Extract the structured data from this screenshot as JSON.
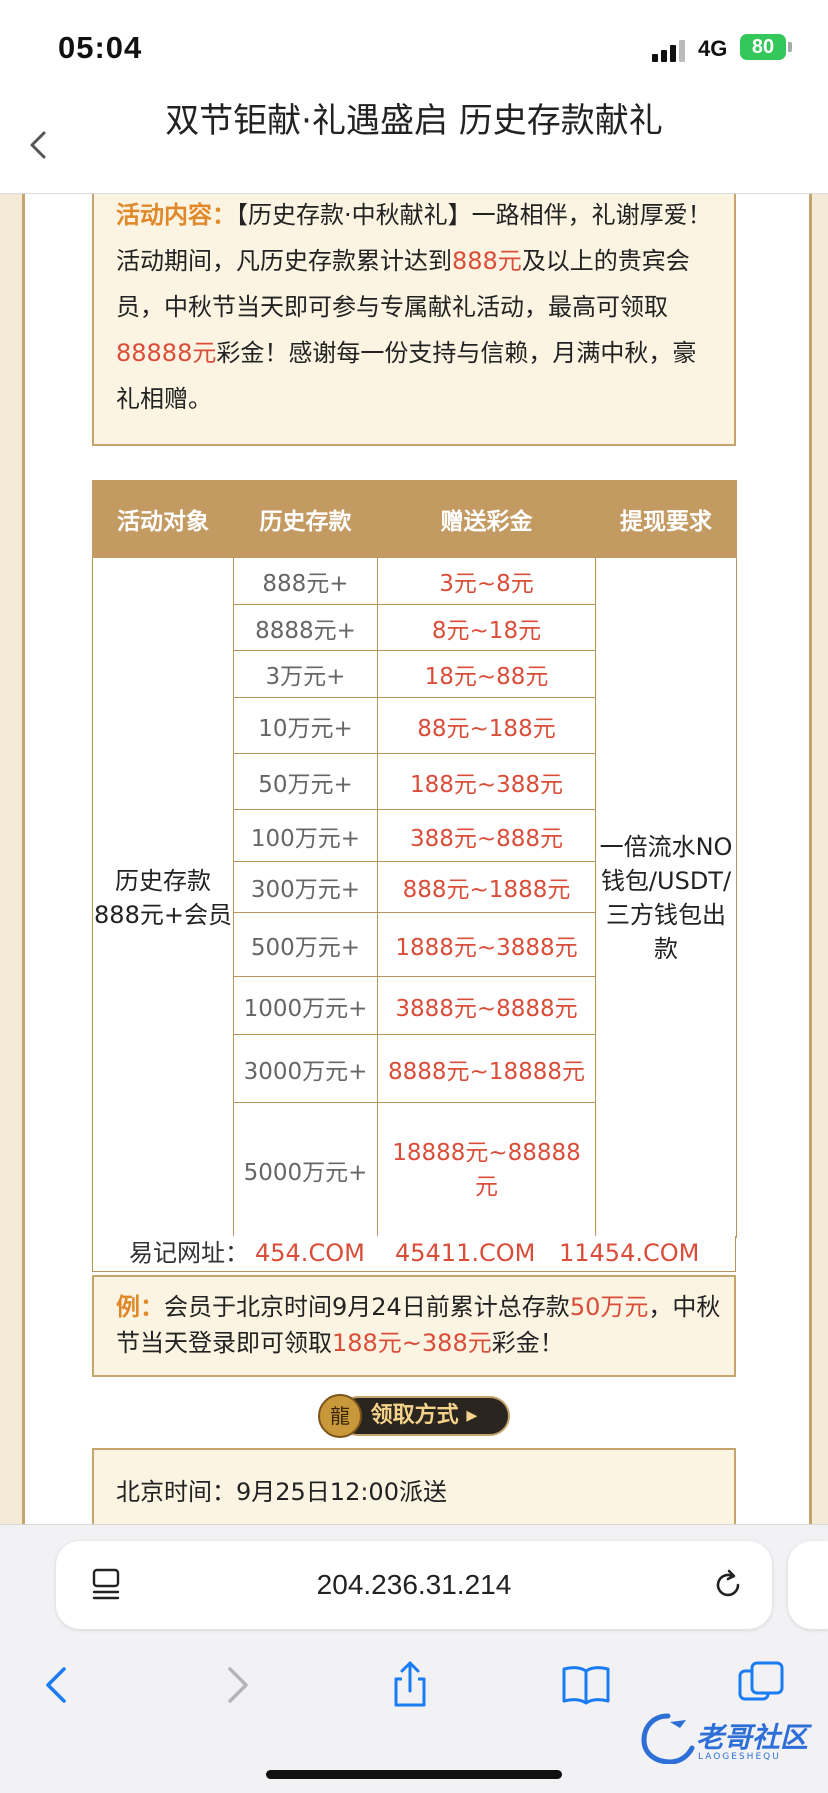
{
  "status": {
    "time": "05:04",
    "network": "4G",
    "battery": "80"
  },
  "nav": {
    "title": "双节钜献·礼遇盛启 历史存款献礼"
  },
  "intro": {
    "label": "活动内容：",
    "t1": "【历史存款·中秋献礼】一路相伴，礼谢厚爱！活动期间，凡历史存款累计达到",
    "amount": "888元",
    "t2": "及以上的贵宾会员，中秋节当天即可参与专属献礼活动，最高可领取",
    "max": "88888元",
    "t3": "彩金！感谢每一份支持与信赖，月满中秋，豪礼相赠。"
  },
  "table": {
    "headers": [
      "活动对象",
      "历史存款",
      "赠送彩金",
      "提现要求"
    ],
    "target": "历史存款888元+会员",
    "requirement": "一倍流水NO钱包/USDT/三方钱包出款",
    "rows": [
      {
        "deposit": "888元+",
        "bonus": "3元~8元"
      },
      {
        "deposit": "8888元+",
        "bonus": "8元~18元"
      },
      {
        "deposit": "3万元+",
        "bonus": "18元~88元"
      },
      {
        "deposit": "10万元+",
        "bonus": "88元~188元"
      },
      {
        "deposit": "50万元+",
        "bonus": "188元~388元"
      },
      {
        "deposit": "100万元+",
        "bonus": "388元~888元"
      },
      {
        "deposit": "300万元+",
        "bonus": "888元~1888元"
      },
      {
        "deposit": "500万元+",
        "bonus": "1888元~3888元"
      },
      {
        "deposit": "1000万元+",
        "bonus": "3888元~8888元"
      },
      {
        "deposit": "3000万元+",
        "bonus": "8888元~18888元"
      },
      {
        "deposit": "5000万元+",
        "bonus": "18888元~88888元"
      }
    ]
  },
  "urls": {
    "label": "易记网址：",
    "u1": "454.COM",
    "u2": "45411.COM",
    "u3": "11454.COM"
  },
  "example": {
    "label": "例：",
    "t1": "会员于北京时间9月24日前累计总存款",
    "amount": "50万元",
    "t2": "，中秋节当天登录即可领取",
    "bonus": "188元~388元",
    "t3": "彩金！"
  },
  "claim": {
    "label": "领取方式"
  },
  "dispatch": {
    "text": "北京时间：9月25日12:00派送"
  },
  "browser": {
    "url": "204.236.31.214"
  },
  "watermark": {
    "text": "老哥社区",
    "sub": "LAOGESHEQU"
  },
  "colors": {
    "accent": "#c49a63",
    "highlight": "#d94d39",
    "label": "#e0892b",
    "battery": "#34c759"
  }
}
